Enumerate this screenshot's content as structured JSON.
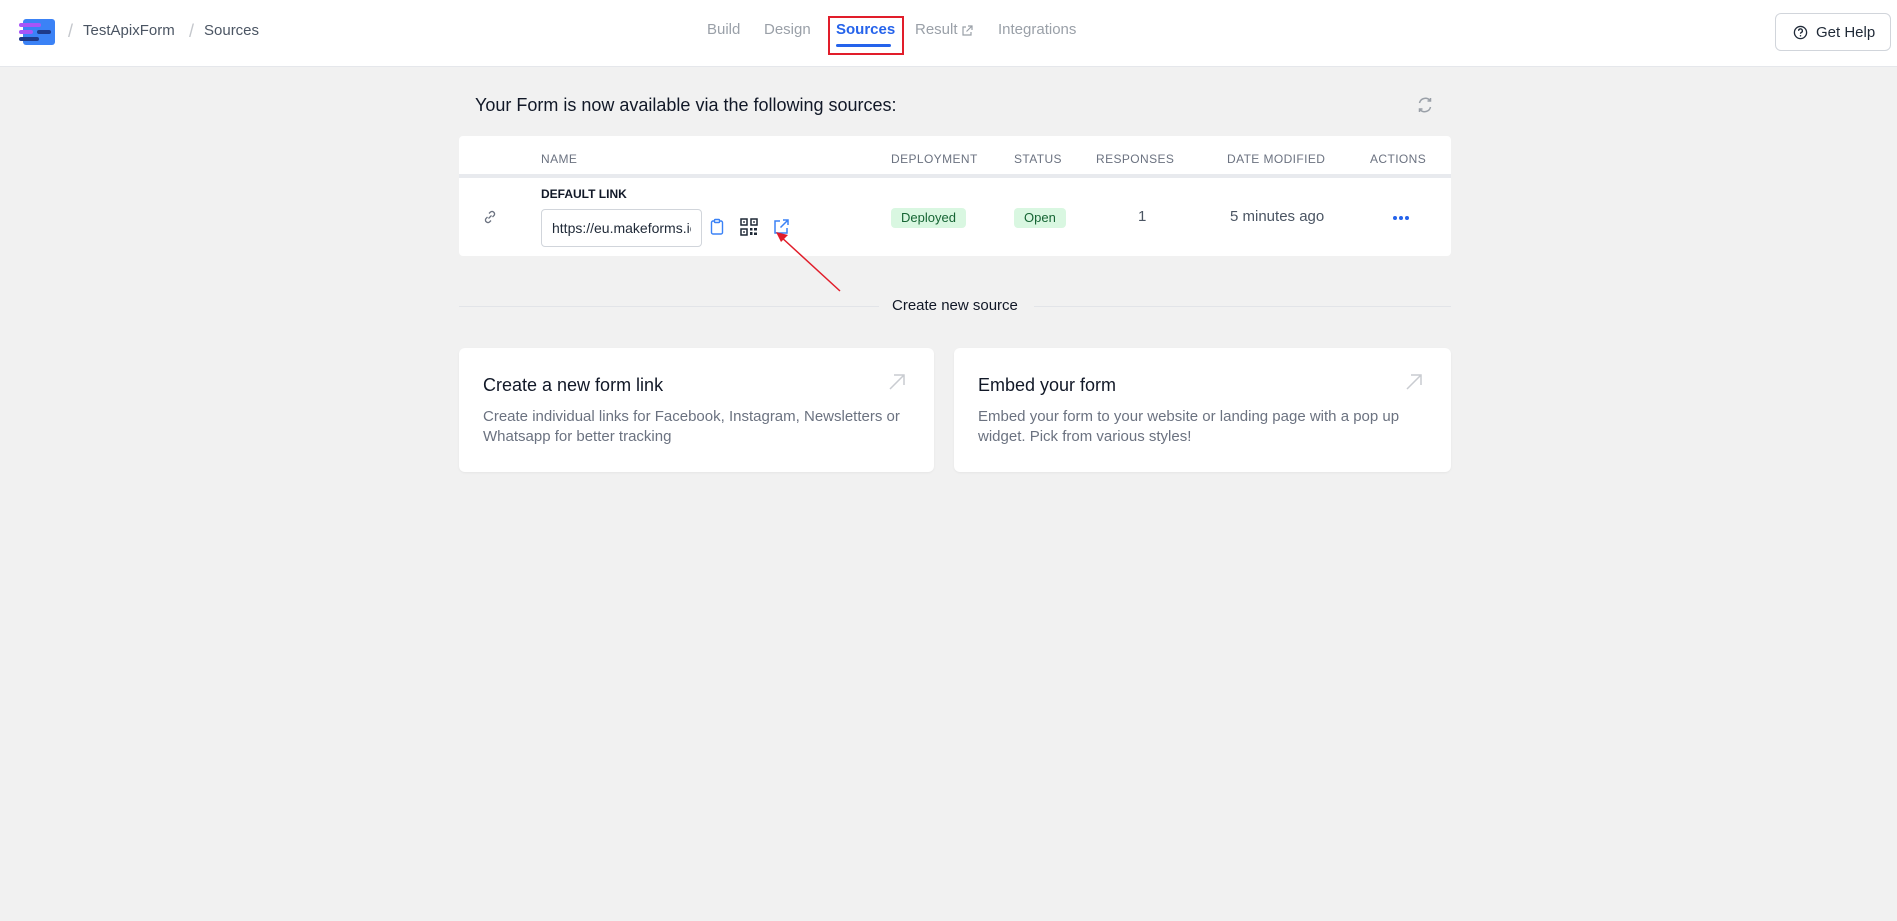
{
  "header": {
    "breadcrumb": [
      "TestApixForm",
      "Sources"
    ],
    "tabs": [
      "Build",
      "Design",
      "Sources",
      "Result",
      "Integrations"
    ],
    "active_tab": "Sources",
    "help_label": "Get Help"
  },
  "sources": {
    "title": "Your Form is now available via the following sources:",
    "columns": [
      "NAME",
      "DEPLOYMENT",
      "STATUS",
      "RESPONSES",
      "DATE MODIFIED",
      "ACTIONS"
    ],
    "rows": [
      {
        "label": "DEFAULT LINK",
        "url": "https://eu.makeforms.io",
        "deployment": "Deployed",
        "status": "Open",
        "responses": "1",
        "date_modified": "5 minutes ago"
      }
    ]
  },
  "create": {
    "label": "Create new source",
    "cards": [
      {
        "title": "Create a new form link",
        "description": [
          "Create individual links for Facebook, Instagram, Newsletters or",
          "Whatsapp for better tracking"
        ]
      },
      {
        "title": "Embed your form",
        "description": [
          "Embed your form to your website or landing page with a pop up",
          "widget. Pick from various styles!"
        ]
      }
    ]
  },
  "colors": {
    "accent": "#2563eb",
    "badge_bg": "#d9f7e1",
    "badge_text": "#166534",
    "highlight": "#e11d2a"
  }
}
